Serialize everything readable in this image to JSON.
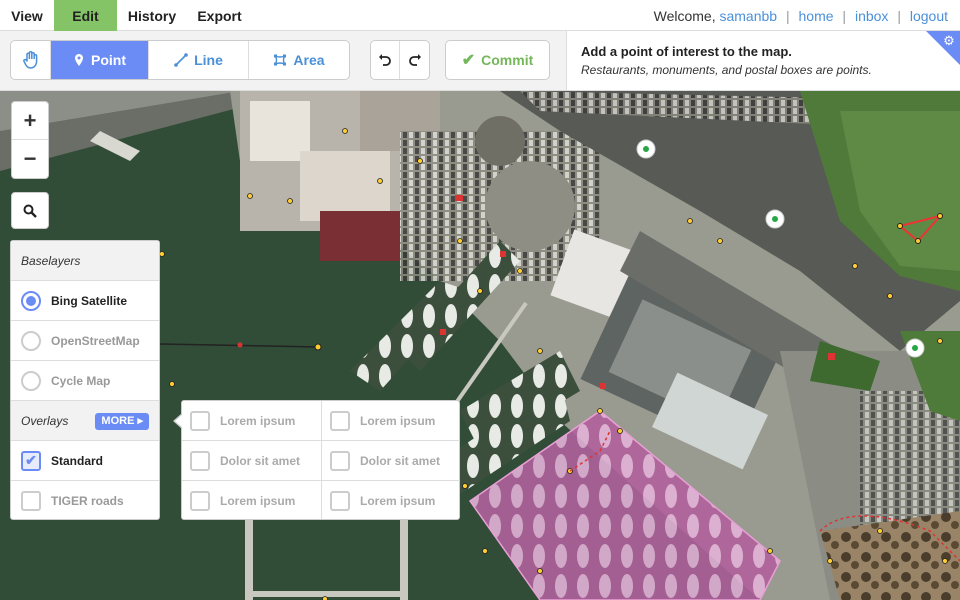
{
  "nav": {
    "tabs": [
      "View",
      "Edit",
      "History",
      "Export"
    ],
    "active_tab": "Edit",
    "welcome": "Welcome,",
    "username": "samanbb",
    "links": [
      "home",
      "inbox",
      "logout"
    ]
  },
  "toolbar": {
    "modes": [
      {
        "label": "",
        "icon": "hand-icon"
      },
      {
        "label": "Point",
        "icon": "pin-icon"
      },
      {
        "label": "Line",
        "icon": "line-icon"
      },
      {
        "label": "Area",
        "icon": "area-icon"
      }
    ],
    "active_mode": "Point",
    "undo_icon": "undo-icon",
    "redo_icon": "redo-icon",
    "commit_label": "Commit"
  },
  "info": {
    "title": "Add a point of interest to the map.",
    "description": "Restaurants, monuments, and postal boxes are points."
  },
  "controls": {
    "zoom_in": "+",
    "zoom_out": "−"
  },
  "layers": {
    "baselayers_heading": "Baselayers",
    "baselayers": [
      {
        "label": "Bing Satellite",
        "selected": true
      },
      {
        "label": "OpenStreetMap",
        "selected": false
      },
      {
        "label": "Cycle Map",
        "selected": false
      }
    ],
    "overlays_heading": "Overlays",
    "more_label": "MORE",
    "overlays": [
      {
        "label": "Standard",
        "checked": true
      },
      {
        "label": "TIGER roads",
        "checked": false
      }
    ]
  },
  "overlay_popup": {
    "items": [
      [
        "Lorem ipsum",
        "Dolor sit amet",
        "Lorem ipsum"
      ],
      [
        "Lorem ipsum",
        "Dolor sit amet",
        "Lorem ipsum"
      ]
    ]
  },
  "colors": {
    "accent": "#6c8cf5",
    "edit_tab": "#84c467",
    "commit": "#74b85a",
    "link": "#4a90d9",
    "water": "#2f4a36",
    "highlight_area": "#e9a0d6"
  }
}
